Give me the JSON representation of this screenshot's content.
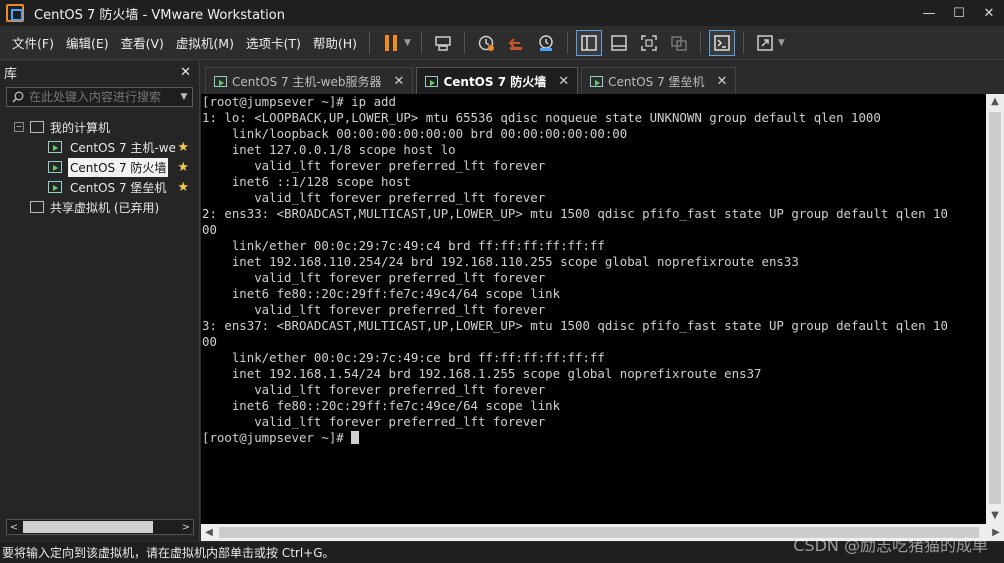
{
  "window": {
    "title": "CentOS 7 防火墙 - VMware Workstation",
    "controls": [
      "—",
      "☐",
      "✕"
    ]
  },
  "menu": [
    "文件(F)",
    "编辑(E)",
    "查看(V)",
    "虚拟机(M)",
    "选项卡(T)",
    "帮助(H)"
  ],
  "toolbar": {
    "icons": [
      "pause-icon",
      "send-ctrl-alt-del-icon",
      "snapshot-icon",
      "revert-snapshot-icon",
      "snapshot-manager-icon",
      "show-library-icon",
      "thumbnail-bar-icon",
      "full-screen-icon",
      "unity-icon",
      "console-view-icon",
      "stretch-guest-icon"
    ],
    "accent": "#f08a24"
  },
  "library": {
    "title": "库",
    "search_placeholder": "在此处键入内容进行搜索",
    "root": "我的计算机",
    "vms": [
      {
        "label": "CentOS 7 主机-we",
        "selected": false
      },
      {
        "label": "CentOS 7 防火墙",
        "selected": true
      },
      {
        "label": "CentOS 7 堡垒机",
        "selected": false
      }
    ],
    "shared": "共享虚拟机 (已弃用)"
  },
  "tabs": [
    {
      "label": "CentOS 7 主机-web服务器",
      "active": false
    },
    {
      "label": "CentOS 7 防火墙",
      "active": true
    },
    {
      "label": "CentOS 7 堡垒机",
      "active": false
    }
  ],
  "terminal": {
    "lines": [
      "[root@jumpsever ~]# ip add",
      "1: lo: <LOOPBACK,UP,LOWER_UP> mtu 65536 qdisc noqueue state UNKNOWN group default qlen 1000",
      "    link/loopback 00:00:00:00:00:00 brd 00:00:00:00:00:00",
      "    inet 127.0.0.1/8 scope host lo",
      "       valid_lft forever preferred_lft forever",
      "    inet6 ::1/128 scope host",
      "       valid_lft forever preferred_lft forever",
      "2: ens33: <BROADCAST,MULTICAST,UP,LOWER_UP> mtu 1500 qdisc pfifo_fast state UP group default qlen 10",
      "00",
      "    link/ether 00:0c:29:7c:49:c4 brd ff:ff:ff:ff:ff:ff",
      "    inet 192.168.110.254/24 brd 192.168.110.255 scope global noprefixroute ens33",
      "       valid_lft forever preferred_lft forever",
      "    inet6 fe80::20c:29ff:fe7c:49c4/64 scope link",
      "       valid_lft forever preferred_lft forever",
      "3: ens37: <BROADCAST,MULTICAST,UP,LOWER_UP> mtu 1500 qdisc pfifo_fast state UP group default qlen 10",
      "00",
      "    link/ether 00:0c:29:7c:49:ce brd ff:ff:ff:ff:ff:ff",
      "    inet 192.168.1.54/24 brd 192.168.1.255 scope global noprefixroute ens37",
      "       valid_lft forever preferred_lft forever",
      "    inet6 fe80::20c:29ff:fe7c:49ce/64 scope link",
      "       valid_lft forever preferred_lft forever",
      "[root@jumpsever ~]# "
    ]
  },
  "status": {
    "text": "要将输入定向到该虚拟机，请在虚拟机内部单击或按 Ctrl+G。"
  },
  "watermark": "CSDN @励志吃猪猫的成单"
}
